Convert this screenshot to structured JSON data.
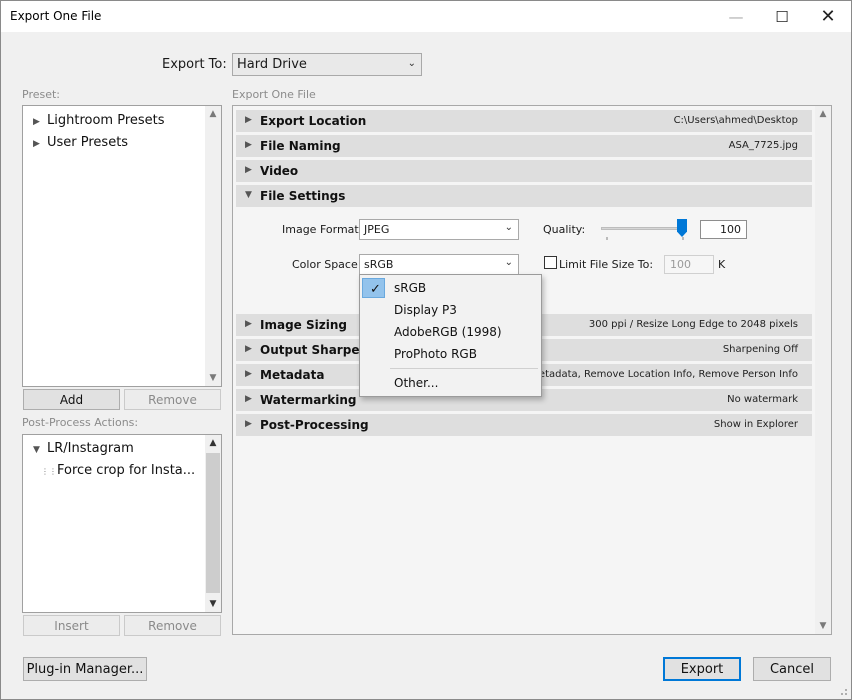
{
  "window": {
    "title": "Export One File",
    "minimize_glyph": "—",
    "maximize_glyph": "☐",
    "close_glyph": "✕"
  },
  "export_to": {
    "label": "Export To:",
    "value": "Hard Drive"
  },
  "preset": {
    "label": "Preset:",
    "items": [
      "Lightroom Presets",
      "User Presets"
    ],
    "add_label": "Add",
    "remove_label": "Remove"
  },
  "post_process": {
    "label": "Post-Process Actions:",
    "group": "LR/Instagram",
    "child": "Force crop for Insta...",
    "insert_label": "Insert",
    "remove_label": "Remove"
  },
  "panel": {
    "caption": "Export One File",
    "sections": [
      {
        "title": "Export Location",
        "summary": "C:\\Users\\ahmed\\Desktop",
        "expanded": false
      },
      {
        "title": "File Naming",
        "summary": "ASA_7725.jpg",
        "expanded": false
      },
      {
        "title": "Video",
        "summary": "",
        "expanded": false
      },
      {
        "title": "File Settings",
        "summary": "",
        "expanded": true
      },
      {
        "title": "Image Sizing",
        "summary": "300 ppi / Resize Long Edge to 2048 pixels",
        "expanded": false
      },
      {
        "title": "Output Sharpening",
        "summary": "Sharpening Off",
        "expanded": false
      },
      {
        "title": "Metadata",
        "summary": "All Metadata, Remove Location Info, Remove Person Info",
        "expanded": false
      },
      {
        "title": "Watermarking",
        "summary": "No watermark",
        "expanded": false
      },
      {
        "title": "Post-Processing",
        "summary": "Show in Explorer",
        "expanded": false
      }
    ]
  },
  "file_settings": {
    "image_format_label": "Image Format:",
    "image_format_value": "JPEG",
    "quality_label": "Quality:",
    "quality_value": "100",
    "quality_fraction": 1.0,
    "color_space_label": "Color Space:",
    "color_space_value": "sRGB",
    "limit_label": "Limit File Size To:",
    "limit_checked": false,
    "limit_value": "100",
    "limit_unit": "K"
  },
  "color_space_menu": {
    "options": [
      "sRGB",
      "Display P3",
      "AdobeRGB (1998)",
      "ProPhoto RGB"
    ],
    "other": "Other...",
    "selected": "sRGB",
    "check_glyph": "✓"
  },
  "footer": {
    "plugin_manager_label": "Plug-in Manager...",
    "export_label": "Export",
    "cancel_label": "Cancel"
  },
  "colors": {
    "accent": "#0078d7",
    "section_header": "#dedede",
    "menu_highlight": "#93c3ec"
  }
}
